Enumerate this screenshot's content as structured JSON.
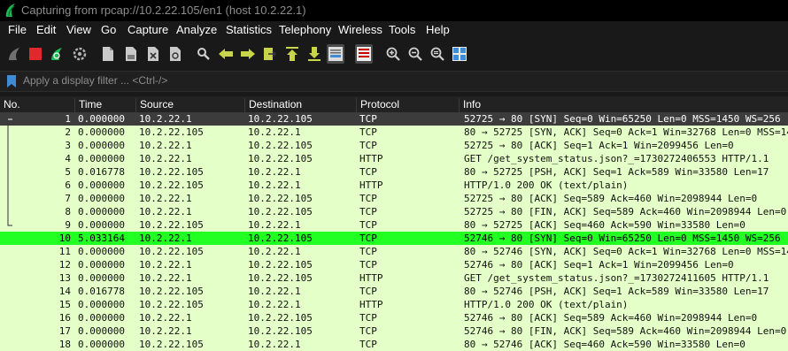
{
  "window": {
    "title": "Capturing from rpcap://10.2.22.105/en1 (host 10.2.22.1)"
  },
  "menu": [
    "File",
    "Edit",
    "View",
    "Go",
    "Capture",
    "Analyze",
    "Statistics",
    "Telephony",
    "Wireless",
    "Tools",
    "Help"
  ],
  "filter": {
    "placeholder": "Apply a display filter ... <Ctrl-/>"
  },
  "columns": {
    "no": "No.",
    "time": "Time",
    "source": "Source",
    "destination": "Destination",
    "protocol": "Protocol",
    "info": "Info"
  },
  "packets": [
    {
      "no": "1",
      "time": "0.000000",
      "source": "10.2.22.1",
      "destination": "10.2.22.105",
      "protocol": "TCP",
      "info": "52725 → 80 [SYN] Seq=0 Win=65250 Len=0 MSS=1450 WS=256"
    },
    {
      "no": "2",
      "time": "0.000000",
      "source": "10.2.22.105",
      "destination": "10.2.22.1",
      "protocol": "TCP",
      "info": "80 → 52725 [SYN, ACK] Seq=0 Ack=1 Win=32768 Len=0 MSS=1460"
    },
    {
      "no": "3",
      "time": "0.000000",
      "source": "10.2.22.1",
      "destination": "10.2.22.105",
      "protocol": "TCP",
      "info": "52725 → 80 [ACK] Seq=1 Ack=1 Win=2099456 Len=0"
    },
    {
      "no": "4",
      "time": "0.000000",
      "source": "10.2.22.1",
      "destination": "10.2.22.105",
      "protocol": "HTTP",
      "info": "GET /get_system_status.json?_=1730272406553 HTTP/1.1"
    },
    {
      "no": "5",
      "time": "0.016778",
      "source": "10.2.22.105",
      "destination": "10.2.22.1",
      "protocol": "TCP",
      "info": "80 → 52725 [PSH, ACK] Seq=1 Ack=589 Win=33580 Len=17"
    },
    {
      "no": "6",
      "time": "0.000000",
      "source": "10.2.22.105",
      "destination": "10.2.22.1",
      "protocol": "HTTP",
      "info": "HTTP/1.0 200 OK  (text/plain)"
    },
    {
      "no": "7",
      "time": "0.000000",
      "source": "10.2.22.1",
      "destination": "10.2.22.105",
      "protocol": "TCP",
      "info": "52725 → 80 [ACK] Seq=589 Ack=460 Win=2098944 Len=0"
    },
    {
      "no": "8",
      "time": "0.000000",
      "source": "10.2.22.1",
      "destination": "10.2.22.105",
      "protocol": "TCP",
      "info": "52725 → 80 [FIN, ACK] Seq=589 Ack=460 Win=2098944 Len=0"
    },
    {
      "no": "9",
      "time": "0.000000",
      "source": "10.2.22.105",
      "destination": "10.2.22.1",
      "protocol": "TCP",
      "info": "80 → 52725 [ACK] Seq=460 Ack=590 Win=33580 Len=0"
    },
    {
      "no": "10",
      "time": "5.033164",
      "source": "10.2.22.1",
      "destination": "10.2.22.105",
      "protocol": "TCP",
      "info": "52746 → 80 [SYN] Seq=0 Win=65250 Len=0 MSS=1450 WS=256"
    },
    {
      "no": "11",
      "time": "0.000000",
      "source": "10.2.22.105",
      "destination": "10.2.22.1",
      "protocol": "TCP",
      "info": "80 → 52746 [SYN, ACK] Seq=0 Ack=1 Win=32768 Len=0 MSS=1460"
    },
    {
      "no": "12",
      "time": "0.000000",
      "source": "10.2.22.1",
      "destination": "10.2.22.105",
      "protocol": "TCP",
      "info": "52746 → 80 [ACK] Seq=1 Ack=1 Win=2099456 Len=0"
    },
    {
      "no": "13",
      "time": "0.000000",
      "source": "10.2.22.1",
      "destination": "10.2.22.105",
      "protocol": "HTTP",
      "info": "GET /get_system_status.json?_=1730272411605 HTTP/1.1"
    },
    {
      "no": "14",
      "time": "0.016778",
      "source": "10.2.22.105",
      "destination": "10.2.22.1",
      "protocol": "TCP",
      "info": "80 → 52746 [PSH, ACK] Seq=1 Ack=589 Win=33580 Len=17"
    },
    {
      "no": "15",
      "time": "0.000000",
      "source": "10.2.22.105",
      "destination": "10.2.22.1",
      "protocol": "HTTP",
      "info": "HTTP/1.0 200 OK  (text/plain)"
    },
    {
      "no": "16",
      "time": "0.000000",
      "source": "10.2.22.1",
      "destination": "10.2.22.105",
      "protocol": "TCP",
      "info": "52746 → 80 [ACK] Seq=589 Ack=460 Win=2098944 Len=0"
    },
    {
      "no": "17",
      "time": "0.000000",
      "source": "10.2.22.1",
      "destination": "10.2.22.105",
      "protocol": "TCP",
      "info": "52746 → 80 [FIN, ACK] Seq=589 Ack=460 Win=2098944 Len=0"
    },
    {
      "no": "18",
      "time": "0.000000",
      "source": "10.2.22.105",
      "destination": "10.2.22.1",
      "protocol": "TCP",
      "info": "80 → 52746 [ACK] Seq=460 Ack=590 Win=33580 Len=0"
    }
  ],
  "selected_packet": "1",
  "highlighted_packet": "10",
  "colors": {
    "row_tcp": "#e4ffc7",
    "row_selected": "#3c3c3c",
    "row_highlight": "#22ff22",
    "accent": "#3f8bd6"
  },
  "toolbar_icons": [
    "shark-fin-start-icon",
    "stop-capture-icon",
    "restart-capture-icon",
    "capture-options-icon",
    "open-file-icon",
    "save-file-icon",
    "close-file-icon",
    "reload-file-icon",
    "find-packet-icon",
    "go-back-icon",
    "go-forward-icon",
    "go-to-packet-icon",
    "go-first-icon",
    "go-last-icon",
    "autoscroll-icon",
    "colorize-icon",
    "zoom-in-icon",
    "zoom-out-icon",
    "zoom-normal-icon",
    "resize-columns-icon"
  ]
}
